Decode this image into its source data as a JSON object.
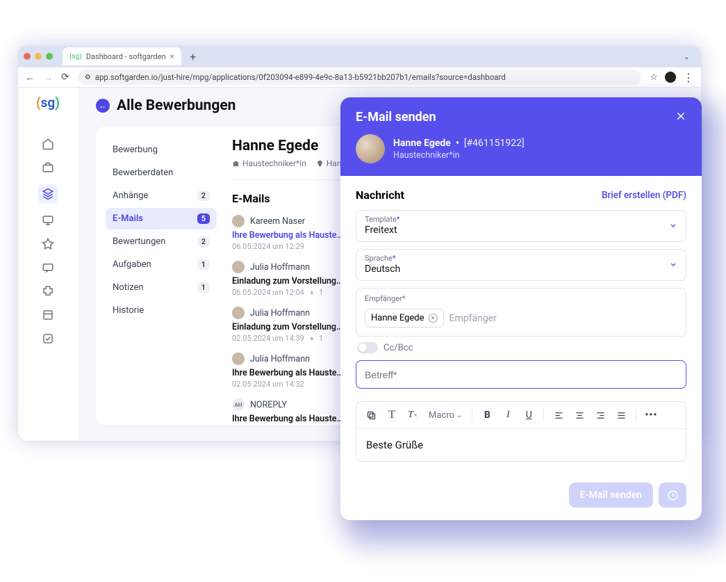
{
  "browser": {
    "tab_title": "Dashboard - softgarden",
    "url": "app.softgarden.io/just-hire/mpg/applications/0f203094-e899-4e9c-8a13-b5921bb207b1/emails?source=dashboard"
  },
  "page": {
    "title": "Alle Bewerbungen"
  },
  "sidemenu": {
    "items": [
      {
        "label": "Bewerbung",
        "badge": ""
      },
      {
        "label": "Bewerberdaten",
        "badge": ""
      },
      {
        "label": "Anhänge",
        "badge": "2"
      },
      {
        "label": "E-Mails",
        "badge": "5",
        "active": true
      },
      {
        "label": "Bewertungen",
        "badge": "2"
      },
      {
        "label": "Aufgaben",
        "badge": "1"
      },
      {
        "label": "Notizen",
        "badge": "1"
      },
      {
        "label": "Historie",
        "badge": ""
      }
    ]
  },
  "candidate": {
    "name": "Hanne Egede",
    "role": "Haustechniker*in",
    "location": "Hamburg"
  },
  "emails": {
    "heading": "E-Mails",
    "list": [
      {
        "sender": "Kareem Naser",
        "subject": "Ihre Bewerbung als Hauste…",
        "ts": "06.05.2024 um 12:29",
        "link": true,
        "attach": false
      },
      {
        "sender": "Julia Hoffmann",
        "subject": "Einladung zum Vorstellungs…",
        "ts": "06.05.2024 um 12:04",
        "link": false,
        "attach": true,
        "attcount": "1"
      },
      {
        "sender": "Julia Hoffmann",
        "subject": "Einladung zum Vorstellungs…",
        "ts": "02.05.2024 um 14:39",
        "link": false,
        "attach": true,
        "attcount": "1"
      },
      {
        "sender": "Julia Hoffmann",
        "subject": "Ihre Bewerbung als Hauste…",
        "ts": "02.05.2024 um 14:32",
        "link": false,
        "attach": false
      },
      {
        "sender": "NOREPLY",
        "subject": "Ihre Bewerbung als Hauste…",
        "ts": "",
        "link": false,
        "noreply": true
      }
    ]
  },
  "modal": {
    "title": "E-Mail senden",
    "person_name": "Hanne Egede",
    "person_id": "[#461151922]",
    "person_role": "Haustechniker*in",
    "section": "Nachricht",
    "pdf_link": "Brief erstellen (PDF)",
    "template_label": "Template",
    "template_value": "Freitext",
    "lang_label": "Sprache",
    "lang_value": "Deutsch",
    "recipient_label": "Empfänger*",
    "recipient_chip": "Hanne Egede",
    "recipient_placeholder": "Empfänger",
    "ccbcc": "Cc/Bcc",
    "subject_placeholder": "Betreff*",
    "macro": "Macro",
    "body": "Beste Grüße",
    "send_btn": "E-Mail senden"
  }
}
